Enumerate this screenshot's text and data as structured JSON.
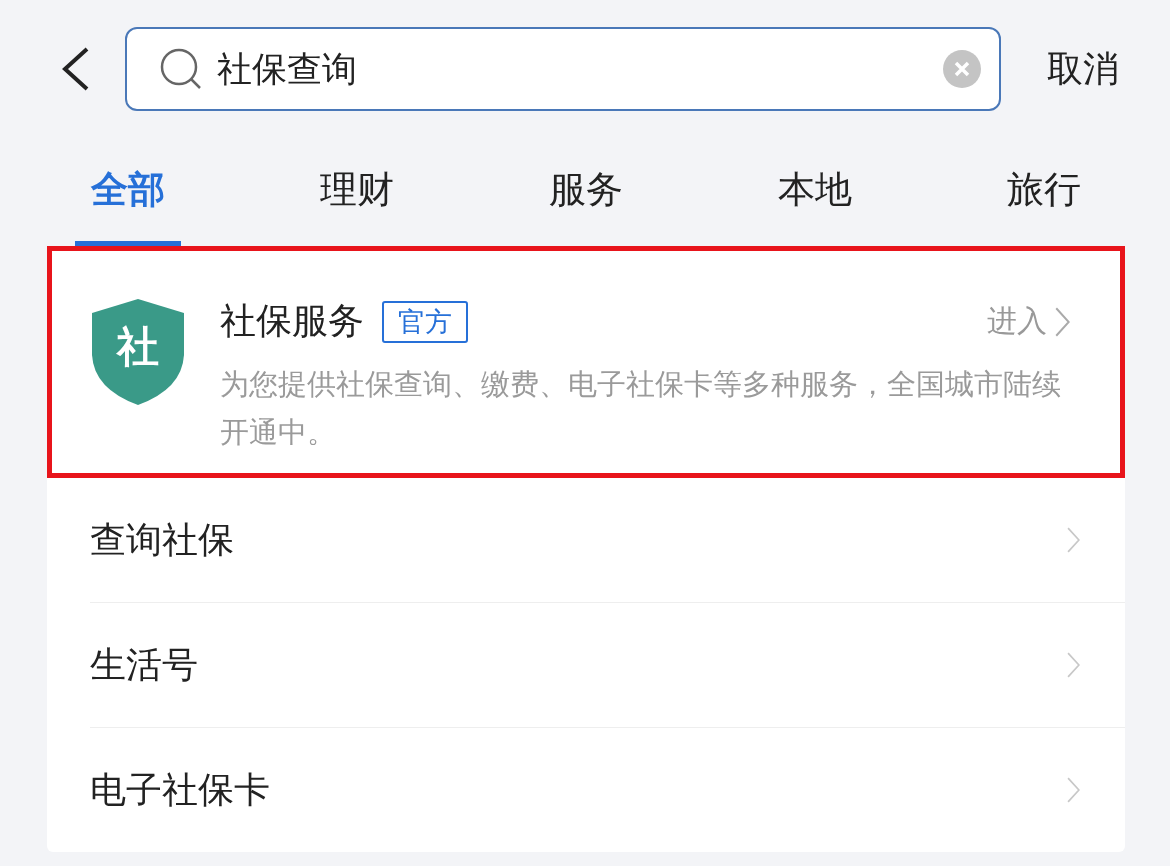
{
  "search": {
    "value": "社保查询",
    "cancel": "取消"
  },
  "tabs": [
    {
      "label": "全部",
      "selected": true
    },
    {
      "label": "理财",
      "selected": false
    },
    {
      "label": "服务",
      "selected": false
    },
    {
      "label": "本地",
      "selected": false
    },
    {
      "label": "旅行",
      "selected": false
    }
  ],
  "featured": {
    "icon_char": "社",
    "title": "社保服务",
    "badge": "官方",
    "action": "进入",
    "description": "为您提供社保查询、缴费、电子社保卡等多种服务，全国城市陆续开通中。",
    "highlighted": true
  },
  "results": [
    {
      "label": "查询社保"
    },
    {
      "label": "生活号"
    },
    {
      "label": "电子社保卡"
    }
  ]
}
